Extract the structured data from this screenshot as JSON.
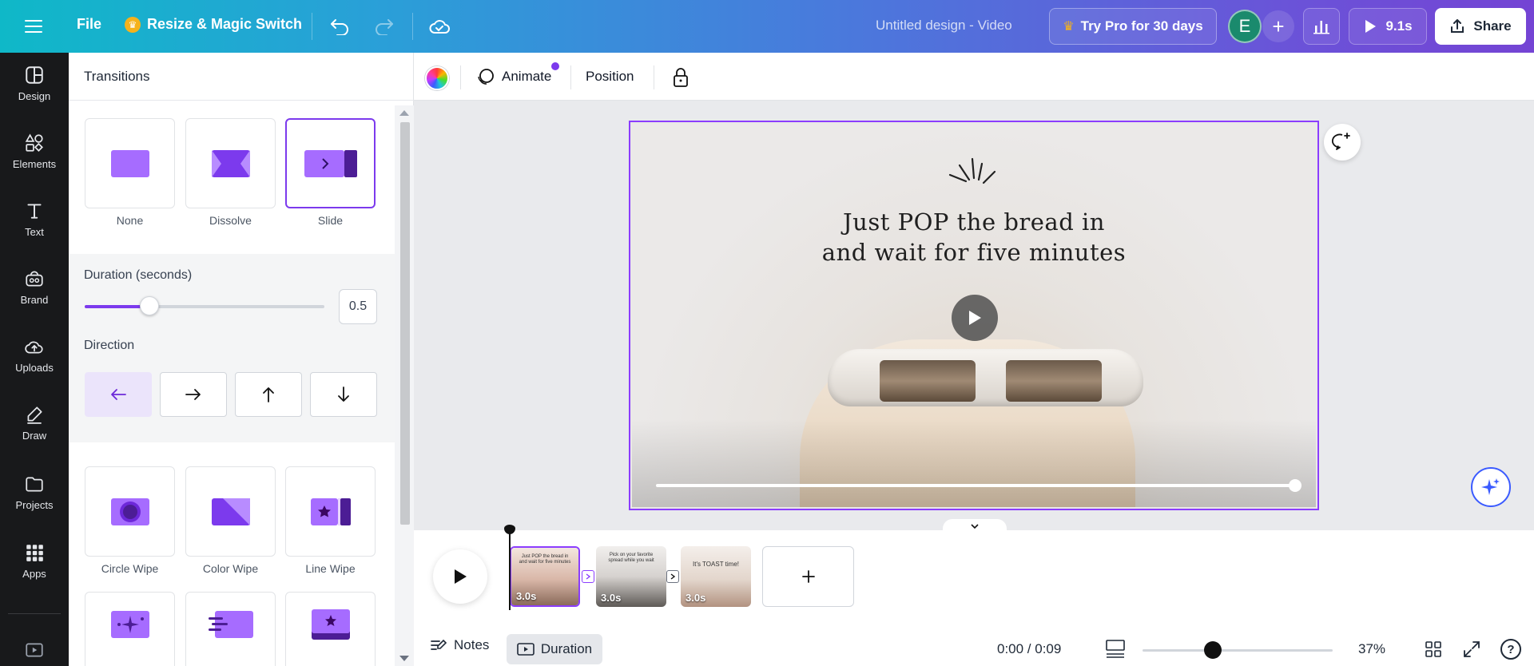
{
  "topbar": {
    "file_label": "File",
    "resize_label": "Resize & Magic Switch",
    "design_title": "Untitled design - Video",
    "pro_label": "Try Pro for 30 days",
    "avatar_initial": "E",
    "play_duration": "9.1s",
    "share_label": "Share"
  },
  "rail": {
    "items": [
      {
        "label": "Design",
        "icon": "design-icon"
      },
      {
        "label": "Elements",
        "icon": "elements-icon"
      },
      {
        "label": "Text",
        "icon": "text-icon"
      },
      {
        "label": "Brand",
        "icon": "brand-icon"
      },
      {
        "label": "Uploads",
        "icon": "uploads-icon"
      },
      {
        "label": "Draw",
        "icon": "draw-icon"
      },
      {
        "label": "Projects",
        "icon": "projects-icon"
      },
      {
        "label": "Apps",
        "icon": "apps-icon"
      }
    ]
  },
  "panel": {
    "title": "Transitions",
    "transitions_top": [
      "None",
      "Dissolve",
      "Slide"
    ],
    "selected_transition": "Slide",
    "duration_label": "Duration (seconds)",
    "duration_value": "0.5",
    "duration_fraction": 0.27,
    "direction_label": "Direction",
    "direction_selected": "left",
    "transitions_more": [
      "Circle Wipe",
      "Color Wipe",
      "Line Wipe"
    ]
  },
  "toolbar": {
    "animate_label": "Animate",
    "position_label": "Position"
  },
  "canvas": {
    "text_line1": "Just POP the bread in",
    "text_line2": "and wait for five minutes"
  },
  "timeline": {
    "clips": [
      {
        "duration": "3.0s",
        "selected": true
      },
      {
        "duration": "3.0s",
        "selected": false
      },
      {
        "duration": "3.0s",
        "selected": false
      }
    ]
  },
  "bottombar": {
    "notes_label": "Notes",
    "duration_label": "Duration",
    "time": "0:00 / 0:09",
    "zoom": "37%",
    "zoom_fraction": 0.37,
    "help_label": "?"
  },
  "colors": {
    "accent": "#8b3dff",
    "rail_bg": "#18191b"
  }
}
